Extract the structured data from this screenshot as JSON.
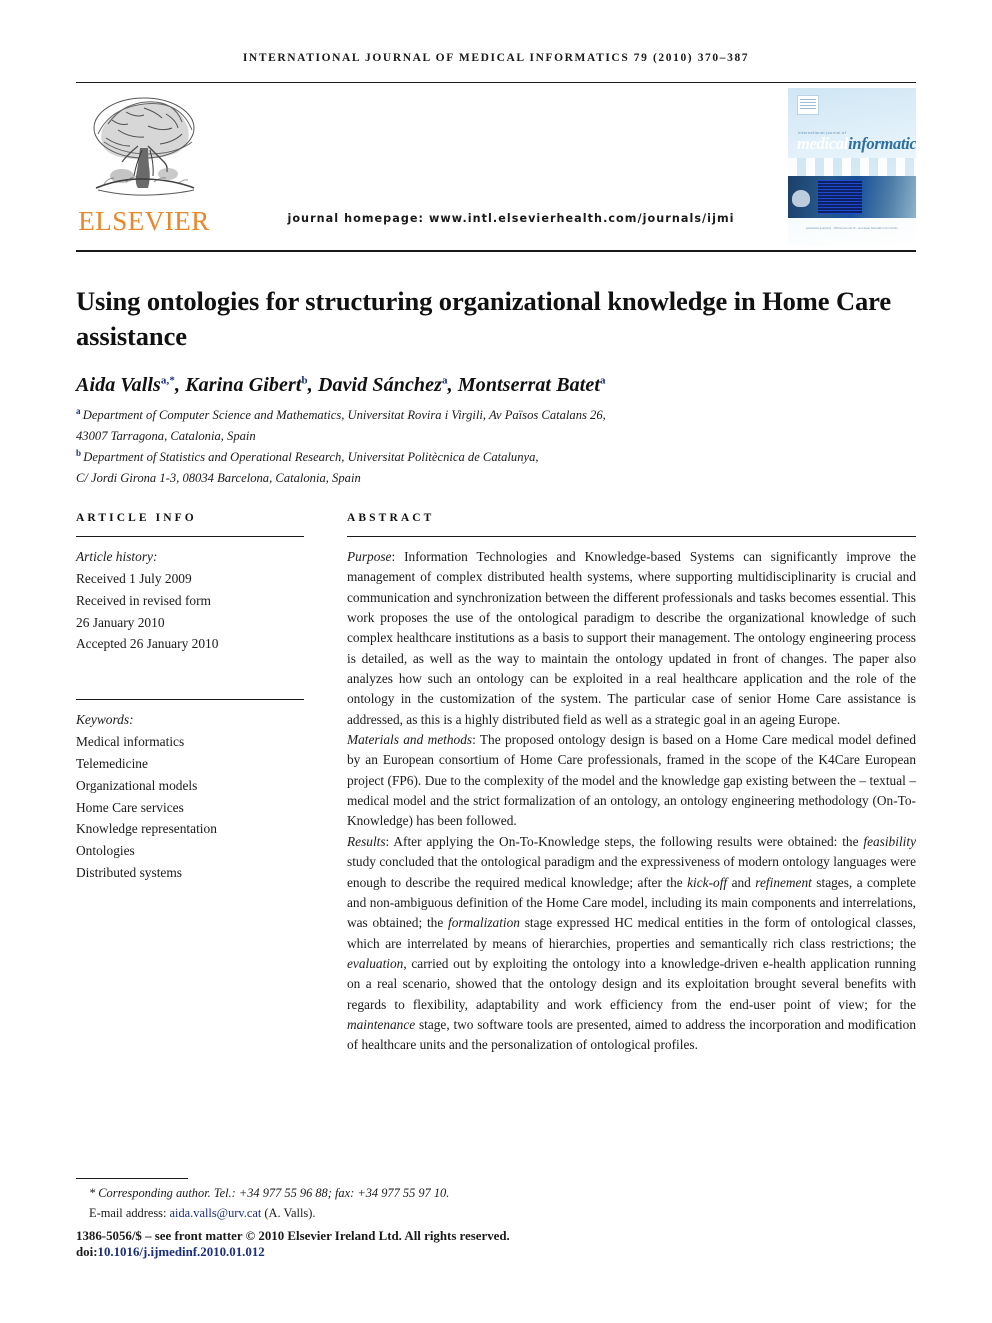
{
  "running_head": "International Journal of Medical Informatics 79 (2010) 370–387",
  "masthead": {
    "publisher_wordmark": "ELSEVIER",
    "homepage_text": "journal homepage: www.intl.elsevierhealth.com/journals/ijmi",
    "cover": {
      "supra_title": "international journal of",
      "title_word_1": "medical",
      "title_word_2": "informatics",
      "caption": "published quarterly · official journal of · european federation for medical informatics"
    }
  },
  "article": {
    "title": "Using ontologies for structuring organizational knowledge in Home Care assistance",
    "authors": [
      {
        "name": "Aida Valls",
        "marks": "a,*"
      },
      {
        "name": "Karina Gibert",
        "marks": "b"
      },
      {
        "name": "David Sánchez",
        "marks": "a"
      },
      {
        "name": "Montserrat Batet",
        "marks": "a"
      }
    ],
    "affiliations": [
      {
        "mark": "a",
        "lines": [
          "Department of Computer Science and Mathematics, Universitat Rovira i Virgili, Av Països Catalans 26,",
          "43007 Tarragona, Catalonia, Spain"
        ]
      },
      {
        "mark": "b",
        "lines": [
          "Department of Statistics and Operational Research, Universitat Politècnica de Catalunya,",
          "C/ Jordi Girona 1-3, 08034 Barcelona, Catalonia, Spain"
        ]
      }
    ]
  },
  "article_info": {
    "heading": "Article info",
    "history_label": "Article history:",
    "history": [
      "Received 1 July 2009",
      "Received in revised form",
      "26 January 2010",
      "Accepted 26 January 2010"
    ],
    "keywords_label": "Keywords:",
    "keywords": [
      "Medical informatics",
      "Telemedicine",
      "Organizational models",
      "Home Care services",
      "Knowledge representation",
      "Ontologies",
      "Distributed systems"
    ]
  },
  "abstract": {
    "heading": "Abstract",
    "purpose_label": "Purpose",
    "purpose_text": ": Information Technologies and Knowledge-based Systems can significantly improve the management of complex distributed health systems, where supporting multidisciplinarity is crucial and communication and synchronization between the different professionals and tasks becomes essential. This work proposes the use of the ontological paradigm to describe the organizational knowledge of such complex healthcare institutions as a basis to support their management. The ontology engineering process is detailed, as well as the way to maintain the ontology updated in front of changes. The paper also analyzes how such an ontology can be exploited in a real healthcare application and the role of the ontology in the customization of the system. The particular case of senior Home Care assistance is addressed, as this is a highly distributed field as well as a strategic goal in an ageing Europe.",
    "materials_label": "Materials and methods",
    "materials_text": ": The proposed ontology design is based on a Home Care medical model defined by an European consortium of Home Care professionals, framed in the scope of the K4Care European project (FP6). Due to the complexity of the model and the knowledge gap existing between the – textual – medical model and the strict formalization of an ontology, an ontology engineering methodology (On-To-Knowledge) has been followed.",
    "results_label": "Results",
    "results_part_1": ": After applying the On-To-Knowledge steps, the following results were obtained: the ",
    "results_em_1": "feasibility",
    "results_part_2": " study concluded that the ontological paradigm and the expressiveness of modern ontology languages were enough to describe the required medical knowledge; after the ",
    "results_em_2": "kick-off",
    "results_part_3": " and ",
    "results_em_3": "refinement",
    "results_part_4": " stages, a complete and non-ambiguous definition of the Home Care model, including its main components and interrelations, was obtained; the ",
    "results_em_4": "formalization",
    "results_part_5": " stage expressed HC medical entities in the form of ontological classes, which are interrelated by means of hierarchies, properties and semantically rich class restrictions; the ",
    "results_em_5": "evaluation",
    "results_part_6": ", carried out by exploiting the ontology into a knowledge-driven e-health application running on a real scenario, showed that the ontology design and its exploitation brought several benefits with regards to flexibility, adaptability and work efficiency from the end-user point of view; for the ",
    "results_em_6": "maintenance",
    "results_part_7": " stage, two software tools are presented, aimed to address the incorporation and modification of healthcare units and the personalization of ontological profiles."
  },
  "footer": {
    "corresponding_author": "* Corresponding author. Tel.: +34 977 55 96 88; fax: +34 977 55 97 10.",
    "email_label": "E-mail address: ",
    "email": "aida.valls@urv.cat",
    "email_suffix": " (A. Valls).",
    "copyright": "1386-5056/$ – see front matter © 2010 Elsevier Ireland Ltd. All rights reserved.",
    "doi_label": "doi:",
    "doi_value": "10.1016/j.ijmedinf.2010.01.012"
  },
  "colors": {
    "elsevier_orange": "#E8872B",
    "link_blue": "#1b2f7a",
    "cover_blue": "#2d6f9e"
  }
}
